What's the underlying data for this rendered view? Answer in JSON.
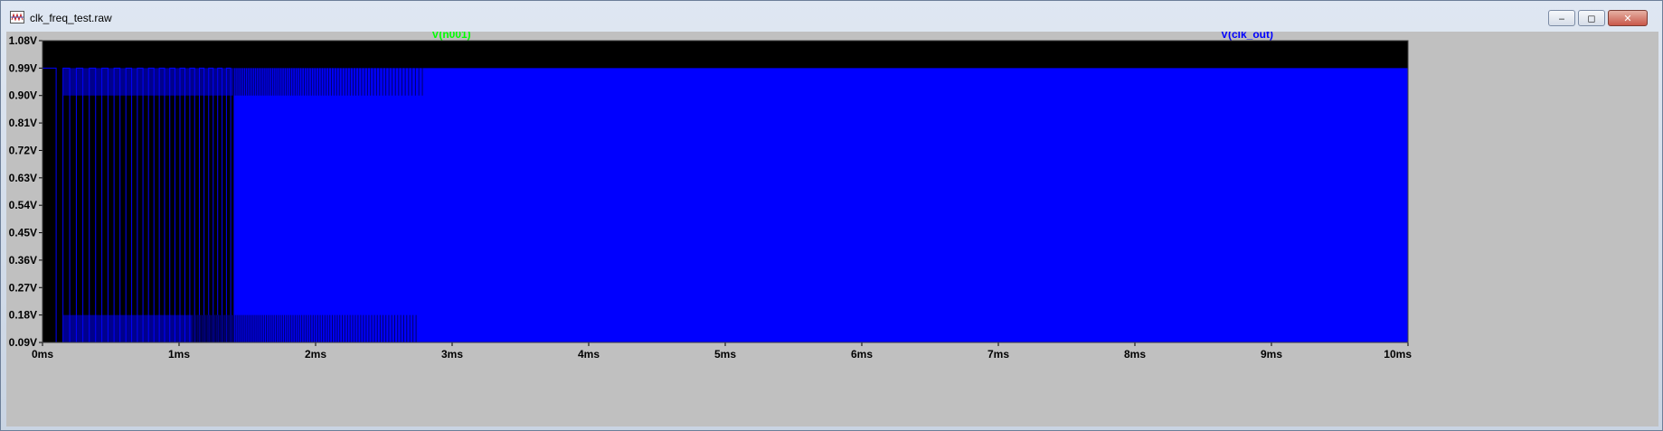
{
  "window": {
    "title": "clk_freq_test.raw",
    "minimize_label": "‒",
    "maximize_label": "◻",
    "close_label": "✕"
  },
  "chart_data": {
    "type": "line",
    "title": "",
    "xlabel": "",
    "ylabel": "",
    "x_unit": "ms",
    "y_unit": "V",
    "xlim": [
      0,
      10
    ],
    "ylim": [
      0.09,
      1.08
    ],
    "x_ticks": [
      "0ms",
      "1ms",
      "2ms",
      "3ms",
      "4ms",
      "5ms",
      "6ms",
      "7ms",
      "8ms",
      "9ms",
      "10ms"
    ],
    "y_ticks": [
      "1.08V",
      "0.99V",
      "0.90V",
      "0.81V",
      "0.72V",
      "0.63V",
      "0.54V",
      "0.45V",
      "0.36V",
      "0.27V",
      "0.18V",
      "0.09V"
    ],
    "series": [
      {
        "name": "V(n001)",
        "color": "#00ff00",
        "description_level_high": 0.99,
        "transitions_until_ms": 2.8
      },
      {
        "name": "V(clk_out)",
        "color": "#0000ff",
        "level_low": 0.09,
        "level_high": 0.99,
        "dense_from_ms": 1.4,
        "dense_to_ms": 10.0
      }
    ],
    "background": "#000000",
    "grid": false
  }
}
